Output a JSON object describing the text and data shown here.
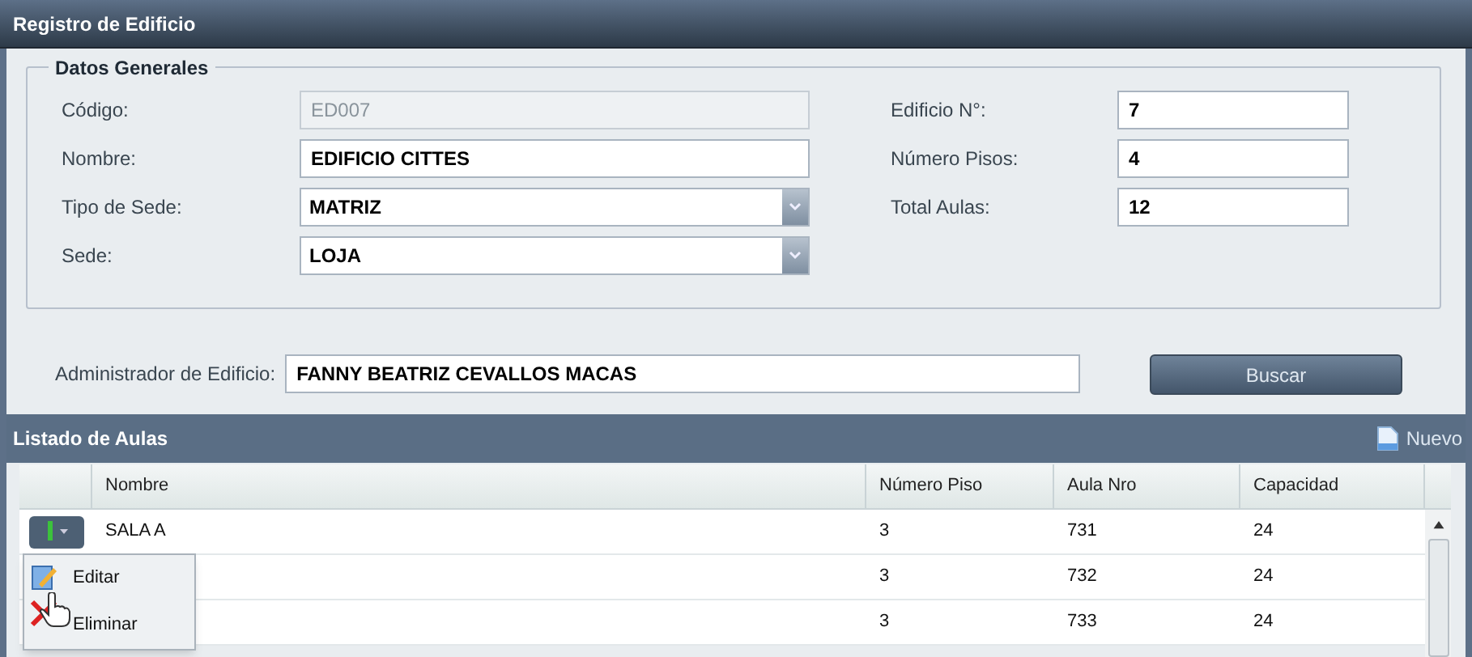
{
  "window": {
    "title": "Registro de Edificio"
  },
  "datos_generales": {
    "legend": "Datos Generales",
    "left_fields": [
      {
        "kind": "text",
        "label": "Código:",
        "value": "ED007",
        "disabled": true
      },
      {
        "kind": "text",
        "label": "Nombre:",
        "value": "EDIFICIO CITTES",
        "disabled": false
      },
      {
        "kind": "select",
        "label": "Tipo de Sede:",
        "value": "MATRIZ",
        "disabled": false
      },
      {
        "kind": "select",
        "label": "Sede:",
        "value": "LOJA",
        "disabled": false
      }
    ],
    "right_fields": [
      {
        "kind": "text",
        "label": "Edificio N°:",
        "value": "7",
        "disabled": false
      },
      {
        "kind": "text",
        "label": "Número Pisos:",
        "value": "4",
        "disabled": false
      },
      {
        "kind": "text",
        "label": "Total Aulas:",
        "value": "12",
        "disabled": false
      }
    ]
  },
  "administrador": {
    "label": "Administrador de Edificio:",
    "value": "FANNY BEATRIZ CEVALLOS MACAS"
  },
  "search_button": "Buscar",
  "listado": {
    "title": "Listado de Aulas",
    "new_button": "Nuevo",
    "columns": [
      "Nombre",
      "Número Piso",
      "Aula Nro",
      "Capacidad"
    ],
    "rows": [
      {
        "cells": [
          "SALA A",
          "3",
          "731",
          "24"
        ]
      },
      {
        "cells": [
          "",
          "3",
          "732",
          "24"
        ]
      },
      {
        "cells": [
          "",
          "3",
          "733",
          "24"
        ]
      }
    ],
    "row_menu": {
      "items": [
        {
          "kind": "edit",
          "label": "Editar"
        },
        {
          "kind": "delete",
          "label": "Eliminar"
        }
      ]
    }
  }
}
